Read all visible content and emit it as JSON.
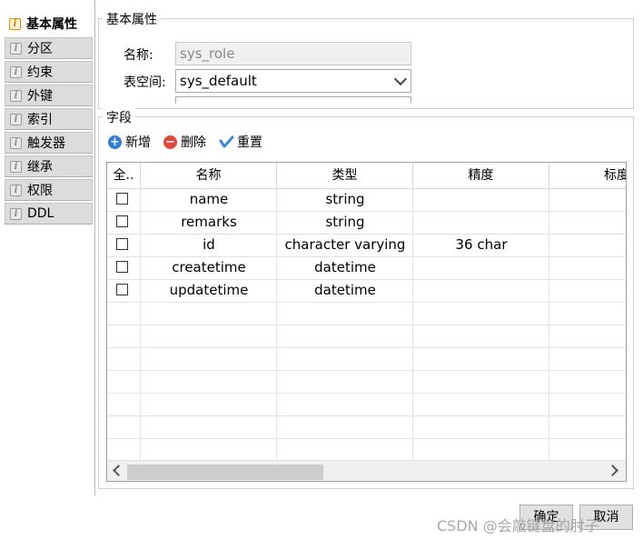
{
  "tabs": [
    {
      "label": "基本属性",
      "active": true
    },
    {
      "label": "分区"
    },
    {
      "label": "约束"
    },
    {
      "label": "外键"
    },
    {
      "label": "索引"
    },
    {
      "label": "触发器"
    },
    {
      "label": "继承"
    },
    {
      "label": "权限"
    },
    {
      "label": "DDL"
    }
  ],
  "basic": {
    "title": "基本属性",
    "name_label": "名称:",
    "name_value": "sys_role",
    "tablespace_label": "表空间:",
    "tablespace_value": "sys_default"
  },
  "fields": {
    "title": "字段",
    "add_label": "新增",
    "delete_label": "删除",
    "reset_label": "重置",
    "columns": [
      "全..",
      "名称",
      "类型",
      "精度",
      "标度"
    ],
    "rows": [
      {
        "name": "name",
        "type": "string",
        "precision": ""
      },
      {
        "name": "remarks",
        "type": "string",
        "precision": ""
      },
      {
        "name": "id",
        "type": "character varying",
        "precision": "36 char"
      },
      {
        "name": "createtime",
        "type": "datetime",
        "precision": ""
      },
      {
        "name": "updatetime",
        "type": "datetime",
        "precision": ""
      }
    ]
  },
  "footer": {
    "ok_label": "确定",
    "cancel_label": "取消"
  },
  "watermark": "CSDN @会敲键盘的肘子",
  "colors": {
    "add": "#2f7fd6",
    "delete": "#e0463c",
    "reset": "#3a86d8"
  }
}
